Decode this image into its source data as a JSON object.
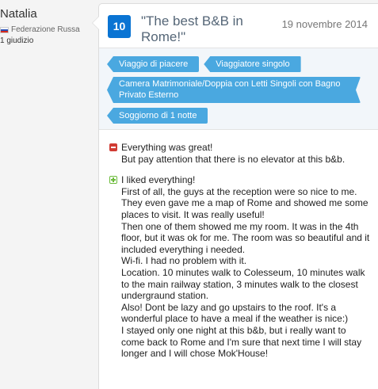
{
  "reviewer": {
    "name": "Natalia",
    "country": "Federazione Russa",
    "review_count": "1 giudizio",
    "flag_icon": "russia-flag-icon"
  },
  "review": {
    "score": "10",
    "title": "\"The best B&B in Rome!\"",
    "date": "19 novembre 2014",
    "tags": [
      "Viaggio di piacere",
      "Viaggiatore singolo",
      "Camera Matrimoniale/Doppia con Letti Singoli con Bagno Privato Esterno",
      "Soggiorno di 1 notte"
    ],
    "negative": {
      "icon": "minus-icon",
      "lines": [
        "Everything was great!",
        "But pay attention that there is no elevator at this b&b."
      ]
    },
    "positive": {
      "icon": "plus-icon",
      "lines": [
        "I liked everything!",
        "First of all, the guys at the reception were so nice to me. They even gave me a map of Rome and showed me some places to visit. It was really useful!",
        "Then one of them showed me my room. It was in the 4th floor, but it was ok for me. The room was so beautiful and it included everything i needed.",
        "Wi-fi. I had no problem with it.",
        "Location. 10 minutes walk to Colesseum, 10 minutes walk to the main railway station, 3 minutes walk to the closest undergraund station.",
        "Also! Dont be lazy and go upstairs to the roof. It's a wonderful place to have a meal if the weather is nice:)",
        "I stayed only one night at this b&b, but i really want to come back to Rome and I'm sure that next time I will stay longer and I will chose Mok'House!"
      ]
    }
  },
  "colors": {
    "score_badge": "#0a74d3",
    "tag": "#4aa8e0",
    "negative": "#d03b33",
    "positive": "#6cbb3c"
  }
}
